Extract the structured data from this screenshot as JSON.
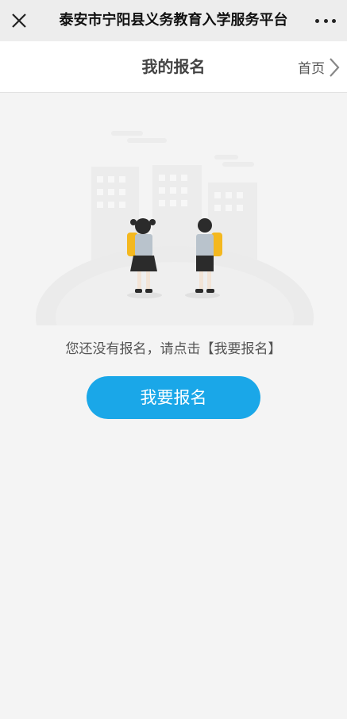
{
  "topbar": {
    "title": "泰安市宁阳县义务教育入学服务平台",
    "close_icon": "close-icon",
    "more_icon": "more-icon"
  },
  "header": {
    "title": "我的报名",
    "home_label": "首页",
    "home_icon": "chevron-right-icon"
  },
  "empty_state": {
    "illustration": "students-city-illustration",
    "message": "您还没有报名，请点击【我要报名】",
    "button_label": "我要报名"
  },
  "colors": {
    "accent": "#1aa7e8",
    "background": "#f4f4f4",
    "topbar": "#ededed"
  }
}
